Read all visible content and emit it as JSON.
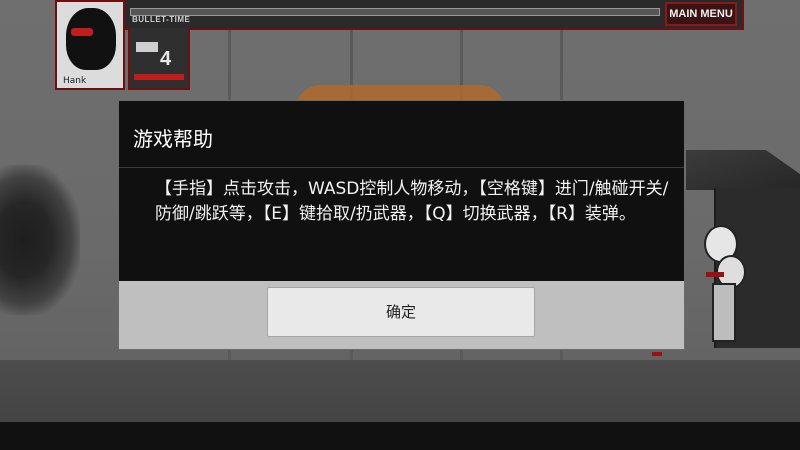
{
  "hud": {
    "character_name": "Hank",
    "bullet_time_label": "BULLET-TIME",
    "ammo_count": "4",
    "main_menu_label": "MAIN MENU",
    "accent_color": "#8a1a1a"
  },
  "dialog": {
    "title": "游戏帮助",
    "message": "【手指】点击攻击，WASD控制人物移动，【空格键】进门/触碰开关/防御/跳跃等，【E】键拾取/扔武器，【Q】切换武器，【R】装弹。",
    "confirm_label": "确定"
  }
}
